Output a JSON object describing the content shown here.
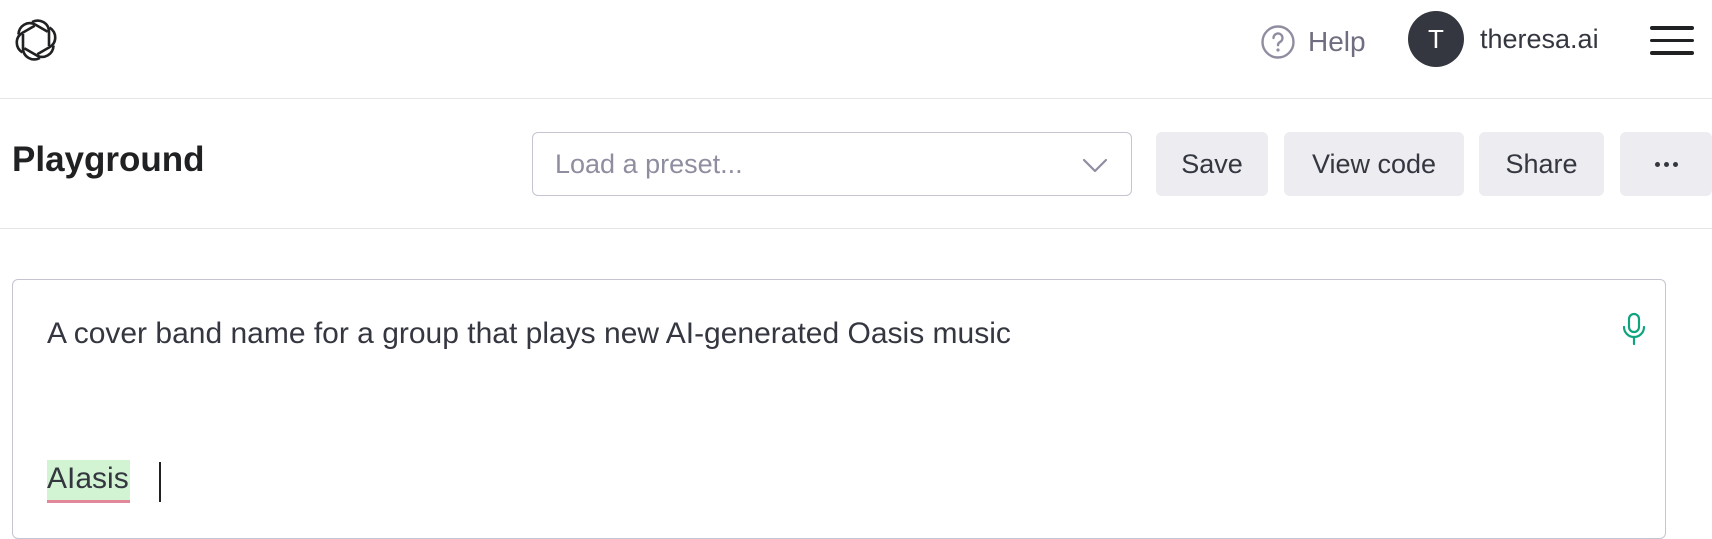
{
  "nav": {
    "logo_icon": "openai-logo-icon",
    "help_label": "Help",
    "avatar_initial": "T",
    "username": "theresa.ai",
    "menu_icon": "hamburger-menu-icon"
  },
  "toolbar": {
    "title": "Playground",
    "preset_placeholder": "Load a preset...",
    "save_label": "Save",
    "view_code_label": "View code",
    "share_label": "Share",
    "more_icon": "ellipsis-icon"
  },
  "editor": {
    "prompt": "A cover band name for a group that plays new AI-generated Oasis music",
    "completion": "AIasis",
    "completion_highlight": "#d2f4d3",
    "mic_icon": "microphone-icon",
    "mic_color": "#10a37f"
  }
}
